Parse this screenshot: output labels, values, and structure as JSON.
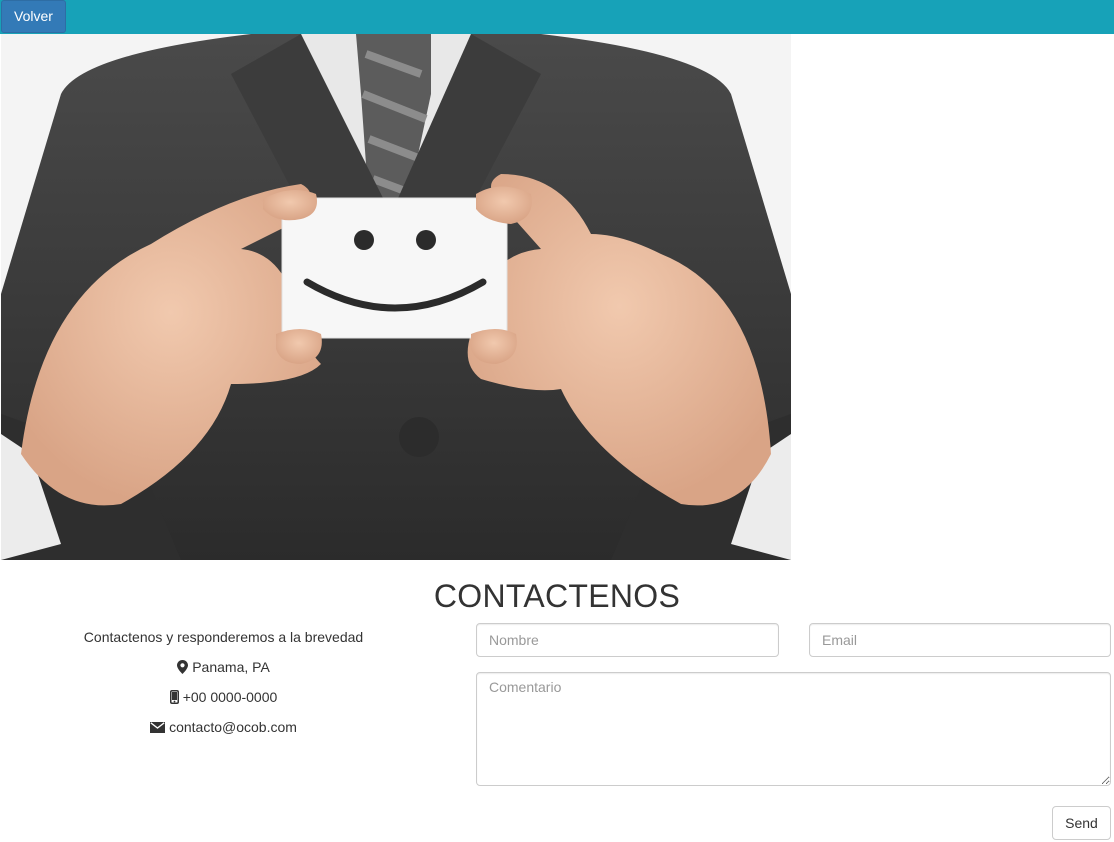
{
  "nav": {
    "back_label": "Volver",
    "bar_color": "#17a2b8",
    "button_color": "#337ab7"
  },
  "hero": {
    "image": "businessman holding card with smiley face",
    "icon": "smiley-card-image"
  },
  "contact": {
    "title": "CONTACTENOS",
    "intro": "Contactenos y responderemos a la brevedad",
    "location": "Panama, PA",
    "phone": "+00 0000-0000",
    "email": "contacto@ocob.com",
    "location_icon": "map-marker-icon",
    "phone_icon": "mobile-phone-icon",
    "email_icon": "envelope-icon"
  },
  "form": {
    "name_placeholder": "Nombre",
    "email_placeholder": "Email",
    "comment_placeholder": "Comentario",
    "send_label": "Send"
  }
}
